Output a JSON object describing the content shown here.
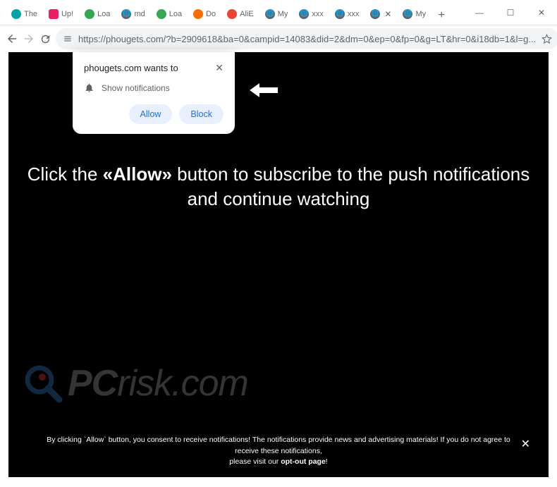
{
  "titlebar": {
    "tabs": [
      {
        "title": "The",
        "favicon": "teal"
      },
      {
        "title": "Up!",
        "favicon": "pink"
      },
      {
        "title": "Loa",
        "favicon": "green"
      },
      {
        "title": "md",
        "favicon": "globe"
      },
      {
        "title": "Loa",
        "favicon": "green"
      },
      {
        "title": "Do",
        "favicon": "orange"
      },
      {
        "title": "AliE",
        "favicon": "red"
      },
      {
        "title": "My",
        "favicon": "globe"
      },
      {
        "title": "xxx",
        "favicon": "globe"
      },
      {
        "title": "xxx",
        "favicon": "globe"
      },
      {
        "title": "",
        "favicon": "globe",
        "active": true
      },
      {
        "title": "My",
        "favicon": "globe"
      }
    ]
  },
  "toolbar": {
    "url": "https://phougets.com/?b=2909618&ba=0&campid=14083&did=2&dm=0&ep=0&fp=0&g=LT&hr=0&i18db=1&l=g..."
  },
  "permission": {
    "origin": "phougets.com wants to",
    "item": "Show notifications",
    "allow": "Allow",
    "block": "Block"
  },
  "page": {
    "headline_pre": "Click the ",
    "headline_bold": "«Allow»",
    "headline_post": " button to subscribe to the push notifications and continue watching"
  },
  "watermark": {
    "text_pc": "PC",
    "text_rest": "risk.com"
  },
  "banner": {
    "text1": "By clicking `Allow` button, you consent to receive notifications! The notifications provide news and advertising materials! If you do not agree to receive these notifications,",
    "text2": "please visit our ",
    "opt": "opt-out page",
    "excl": "!"
  }
}
